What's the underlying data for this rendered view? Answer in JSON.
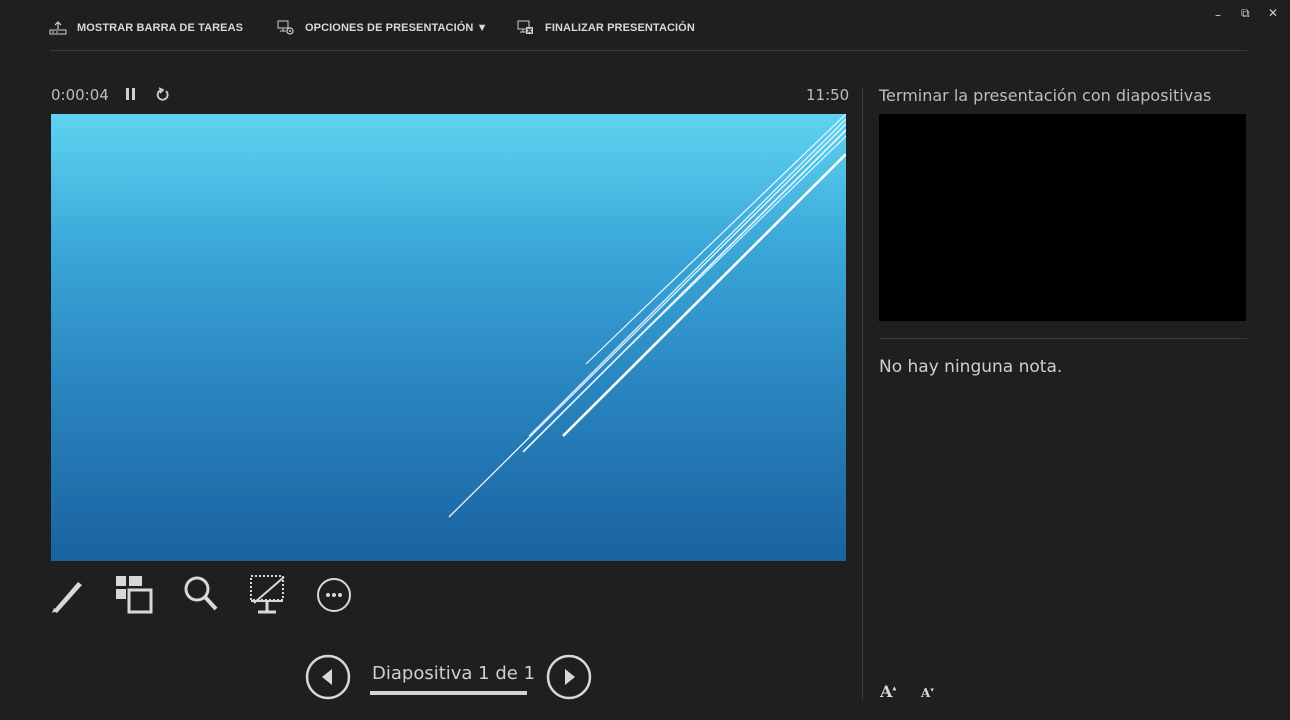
{
  "toolbar": {
    "show_taskbar": "MOSTRAR BARRA DE TAREAS",
    "display_settings": "OPCIONES DE PRESENTACIÓN ▼",
    "end_show": "FINALIZAR PRESENTACIÓN"
  },
  "window_controls": {
    "minimize": "–",
    "restore": "⧉",
    "close": "✕"
  },
  "timer": {
    "elapsed": "0:00:04",
    "clock": "11:50"
  },
  "current_slide": {
    "label": "Diapositiva 1 de 1"
  },
  "next_slide": {
    "title": "Terminar la presentación con diapositivas"
  },
  "notes": {
    "text": "No hay ninguna nota."
  },
  "font_controls": {
    "increase": "A",
    "decrease": "A"
  },
  "icons": [
    "taskbar-icon",
    "display-settings-icon",
    "end-show-icon",
    "pause-icon",
    "restart-icon",
    "pen-icon",
    "see-all-slides-icon",
    "zoom-icon",
    "black-screen-icon",
    "more-options-icon",
    "previous-icon",
    "next-icon"
  ],
  "colors": {
    "background": "#1f1f1f",
    "slide_top": "#5fd3f0",
    "slide_bottom": "#1a62a0",
    "text": "#cfcfcf"
  }
}
